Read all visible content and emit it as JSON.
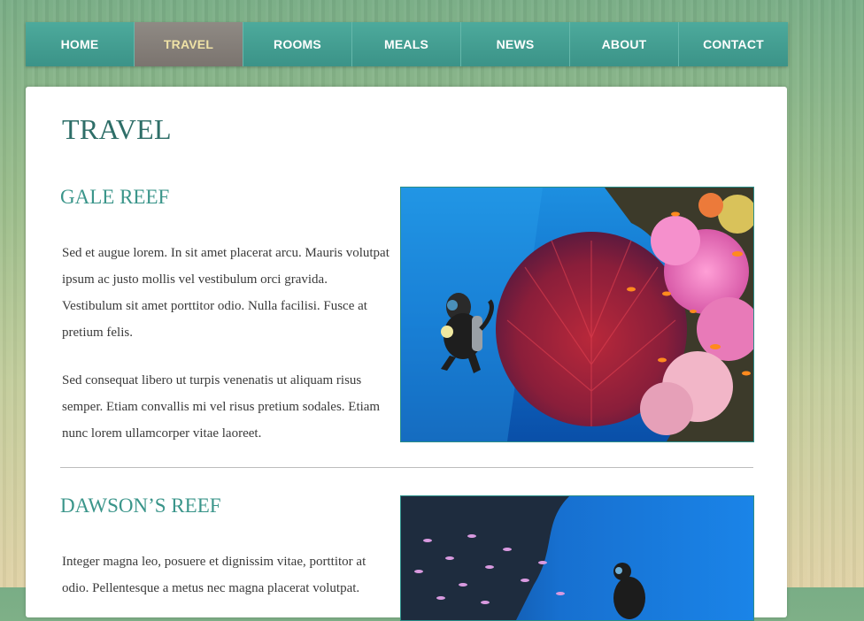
{
  "nav": {
    "items": [
      {
        "label": "HOME"
      },
      {
        "label": "TRAVEL",
        "active": true
      },
      {
        "label": "ROOMS"
      },
      {
        "label": "MEALS"
      },
      {
        "label": "NEWS"
      },
      {
        "label": "ABOUT"
      },
      {
        "label": "CONTACT"
      }
    ],
    "colors": {
      "item": "#43a093",
      "active": "#857f79",
      "active_text": "#f0e2a6"
    }
  },
  "page": {
    "title": "TRAVEL"
  },
  "sections": [
    {
      "title": "GALE REEF",
      "paragraphs": [
        "Sed et augue lorem. In sit amet placerat arcu. Mauris volutpat ipsum ac justo mollis vel vestibulum orci gravida. Vestibulum sit amet porttitor odio. Nulla facilisi. Fusce at pretium felis.",
        "Sed consequat libero ut turpis venenatis ut aliquam risus semper. Etiam convallis mi vel risus pretium sodales. Etiam nunc lorem ullamcorper vitae laoreet."
      ],
      "image": "diver-soft-coral-photo"
    },
    {
      "title": "DAWSON’S REEF",
      "paragraphs": [
        "Integer magna leo, posuere et dignissim vitae, porttitor at odio. Pellentesque a metus nec magna placerat volutpat."
      ],
      "image": "diver-reef-wall-photo"
    }
  ]
}
